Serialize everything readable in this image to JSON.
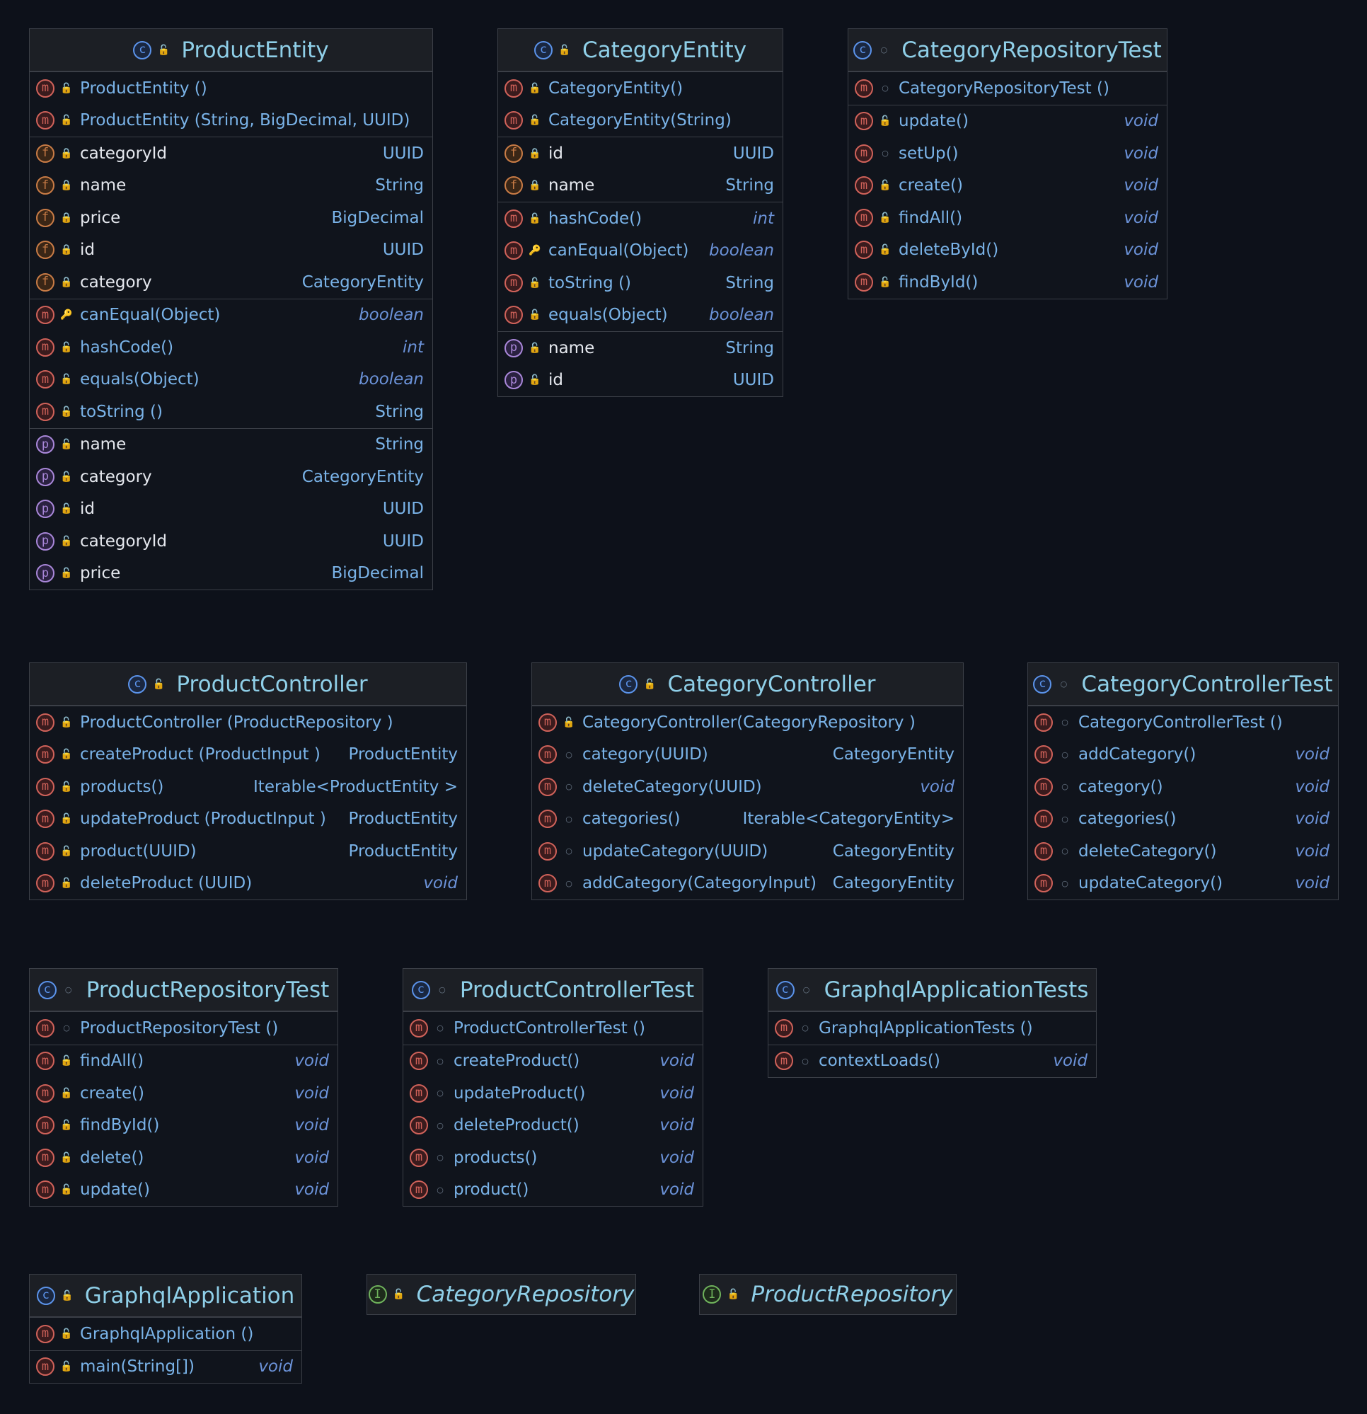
{
  "classes": [
    {
      "id": "product-entity",
      "kind": "c",
      "visibility": "public",
      "title": "ProductEntity",
      "sections": [
        [
          {
            "kind": "m",
            "vis": "public",
            "name": "ProductEntity ()",
            "type": ""
          },
          {
            "kind": "m",
            "vis": "public",
            "name": "ProductEntity (String, BigDecimal, UUID)",
            "type": ""
          }
        ],
        [
          {
            "kind": "f",
            "vis": "private",
            "name": "categoryId",
            "type": "UUID"
          },
          {
            "kind": "f",
            "vis": "private",
            "name": "name",
            "type": "String"
          },
          {
            "kind": "f",
            "vis": "private",
            "name": "price",
            "type": "BigDecimal"
          },
          {
            "kind": "f",
            "vis": "private",
            "name": "id",
            "type": "UUID"
          },
          {
            "kind": "f",
            "vis": "private",
            "name": "category",
            "type": "CategoryEntity"
          }
        ],
        [
          {
            "kind": "m",
            "vis": "protected",
            "name": "canEqual(Object)",
            "type": "boolean",
            "italic": true
          },
          {
            "kind": "m",
            "vis": "public",
            "name": "hashCode()",
            "type": "int",
            "italic": true
          },
          {
            "kind": "m",
            "vis": "public",
            "name": "equals(Object)",
            "type": "boolean",
            "italic": true
          },
          {
            "kind": "m",
            "vis": "public",
            "name": "toString ()",
            "type": "String"
          }
        ],
        [
          {
            "kind": "p",
            "vis": "public",
            "name": "name",
            "type": "String"
          },
          {
            "kind": "p",
            "vis": "public",
            "name": "category",
            "type": "CategoryEntity"
          },
          {
            "kind": "p",
            "vis": "public",
            "name": "id",
            "type": "UUID"
          },
          {
            "kind": "p",
            "vis": "public",
            "name": "categoryId",
            "type": "UUID"
          },
          {
            "kind": "p",
            "vis": "public",
            "name": "price",
            "type": "BigDecimal"
          }
        ]
      ]
    },
    {
      "id": "category-entity",
      "kind": "c",
      "visibility": "public",
      "title": "CategoryEntity",
      "sections": [
        [
          {
            "kind": "m",
            "vis": "public",
            "name": "CategoryEntity()",
            "type": ""
          },
          {
            "kind": "m",
            "vis": "public",
            "name": "CategoryEntity(String)",
            "type": ""
          }
        ],
        [
          {
            "kind": "f",
            "vis": "private",
            "name": "id",
            "type": "UUID"
          },
          {
            "kind": "f",
            "vis": "private",
            "name": "name",
            "type": "String"
          }
        ],
        [
          {
            "kind": "m",
            "vis": "public",
            "name": "hashCode()",
            "type": "int",
            "italic": true
          },
          {
            "kind": "m",
            "vis": "protected",
            "name": "canEqual(Object)",
            "type": "boolean",
            "italic": true
          },
          {
            "kind": "m",
            "vis": "public",
            "name": "toString ()",
            "type": "String"
          },
          {
            "kind": "m",
            "vis": "public",
            "name": "equals(Object)",
            "type": "boolean",
            "italic": true
          }
        ],
        [
          {
            "kind": "p",
            "vis": "public",
            "name": "name",
            "type": "String"
          },
          {
            "kind": "p",
            "vis": "public",
            "name": "id",
            "type": "UUID"
          }
        ]
      ]
    },
    {
      "id": "category-repository-test",
      "kind": "c",
      "visibility": "package",
      "title": "CategoryRepositoryTest",
      "sections": [
        [
          {
            "kind": "m",
            "vis": "package",
            "name": "CategoryRepositoryTest ()",
            "type": ""
          }
        ],
        [
          {
            "kind": "m",
            "vis": "public",
            "name": "update()",
            "type": "void",
            "italic": true
          },
          {
            "kind": "m",
            "vis": "package",
            "name": "setUp()",
            "type": "void",
            "italic": true
          },
          {
            "kind": "m",
            "vis": "public",
            "name": "create()",
            "type": "void",
            "italic": true
          },
          {
            "kind": "m",
            "vis": "public",
            "name": "findAll()",
            "type": "void",
            "italic": true
          },
          {
            "kind": "m",
            "vis": "public",
            "name": "deleteById()",
            "type": "void",
            "italic": true
          },
          {
            "kind": "m",
            "vis": "public",
            "name": "findById()",
            "type": "void",
            "italic": true
          }
        ]
      ]
    },
    {
      "id": "product-controller",
      "kind": "c",
      "visibility": "public",
      "title": "ProductController",
      "sections": [
        [
          {
            "kind": "m",
            "vis": "public",
            "name": "ProductController (ProductRepository )",
            "type": ""
          },
          {
            "kind": "m",
            "vis": "public",
            "name": "createProduct (ProductInput )",
            "type": "ProductEntity"
          },
          {
            "kind": "m",
            "vis": "public",
            "name": "products()",
            "type": "Iterable<ProductEntity >"
          },
          {
            "kind": "m",
            "vis": "public",
            "name": "updateProduct (ProductInput )",
            "type": "ProductEntity"
          },
          {
            "kind": "m",
            "vis": "public",
            "name": "product(UUID)",
            "type": "ProductEntity"
          },
          {
            "kind": "m",
            "vis": "public",
            "name": "deleteProduct (UUID)",
            "type": "void",
            "italic": true
          }
        ]
      ]
    },
    {
      "id": "category-controller",
      "kind": "c",
      "visibility": "public",
      "title": "CategoryController",
      "sections": [
        [
          {
            "kind": "m",
            "vis": "public",
            "name": "CategoryController(CategoryRepository )",
            "type": ""
          },
          {
            "kind": "m",
            "vis": "package",
            "name": "category(UUID)",
            "type": "CategoryEntity"
          },
          {
            "kind": "m",
            "vis": "package",
            "name": "deleteCategory(UUID)",
            "type": "void",
            "italic": true
          },
          {
            "kind": "m",
            "vis": "package",
            "name": "categories()",
            "type": "Iterable<CategoryEntity>"
          },
          {
            "kind": "m",
            "vis": "package",
            "name": "updateCategory(UUID)",
            "type": "CategoryEntity"
          },
          {
            "kind": "m",
            "vis": "package",
            "name": "addCategory(CategoryInput)",
            "type": "CategoryEntity"
          }
        ]
      ]
    },
    {
      "id": "category-controller-test",
      "kind": "c",
      "visibility": "package",
      "title": "CategoryControllerTest",
      "sections": [
        [
          {
            "kind": "m",
            "vis": "package",
            "name": "CategoryControllerTest ()",
            "type": ""
          },
          {
            "kind": "m",
            "vis": "package",
            "name": "addCategory()",
            "type": "void",
            "italic": true
          },
          {
            "kind": "m",
            "vis": "package",
            "name": "category()",
            "type": "void",
            "italic": true
          },
          {
            "kind": "m",
            "vis": "package",
            "name": "categories()",
            "type": "void",
            "italic": true
          },
          {
            "kind": "m",
            "vis": "package",
            "name": "deleteCategory()",
            "type": "void",
            "italic": true
          },
          {
            "kind": "m",
            "vis": "package",
            "name": "updateCategory()",
            "type": "void",
            "italic": true
          }
        ]
      ]
    },
    {
      "id": "product-repository-test",
      "kind": "c",
      "visibility": "package",
      "title": "ProductRepositoryTest",
      "sections": [
        [
          {
            "kind": "m",
            "vis": "package",
            "name": "ProductRepositoryTest ()",
            "type": ""
          }
        ],
        [
          {
            "kind": "m",
            "vis": "public",
            "name": "findAll()",
            "type": "void",
            "italic": true
          },
          {
            "kind": "m",
            "vis": "public",
            "name": "create()",
            "type": "void",
            "italic": true
          },
          {
            "kind": "m",
            "vis": "public",
            "name": "findById()",
            "type": "void",
            "italic": true
          },
          {
            "kind": "m",
            "vis": "public",
            "name": "delete()",
            "type": "void",
            "italic": true
          },
          {
            "kind": "m",
            "vis": "public",
            "name": "update()",
            "type": "void",
            "italic": true
          }
        ]
      ]
    },
    {
      "id": "product-controller-test",
      "kind": "c",
      "visibility": "package",
      "title": "ProductControllerTest",
      "sections": [
        [
          {
            "kind": "m",
            "vis": "package",
            "name": "ProductControllerTest ()",
            "type": ""
          }
        ],
        [
          {
            "kind": "m",
            "vis": "package",
            "name": "createProduct()",
            "type": "void",
            "italic": true
          },
          {
            "kind": "m",
            "vis": "package",
            "name": "updateProduct()",
            "type": "void",
            "italic": true
          },
          {
            "kind": "m",
            "vis": "package",
            "name": "deleteProduct()",
            "type": "void",
            "italic": true
          },
          {
            "kind": "m",
            "vis": "package",
            "name": "products()",
            "type": "void",
            "italic": true
          },
          {
            "kind": "m",
            "vis": "package",
            "name": "product()",
            "type": "void",
            "italic": true
          }
        ]
      ]
    },
    {
      "id": "graphql-application-tests",
      "kind": "c",
      "visibility": "package",
      "title": "GraphqlApplicationTests",
      "sections": [
        [
          {
            "kind": "m",
            "vis": "package",
            "name": "GraphqlApplicationTests ()",
            "type": ""
          }
        ],
        [
          {
            "kind": "m",
            "vis": "package",
            "name": "contextLoads()",
            "type": "void",
            "italic": true
          }
        ]
      ]
    },
    {
      "id": "graphql-application",
      "kind": "c",
      "visibility": "public",
      "title": "GraphqlApplication",
      "sections": [
        [
          {
            "kind": "m",
            "vis": "public",
            "name": "GraphqlApplication ()",
            "type": ""
          }
        ],
        [
          {
            "kind": "m",
            "vis": "public",
            "name": "main(String[])",
            "type": "void",
            "italic": true
          }
        ]
      ]
    },
    {
      "id": "category-repository",
      "kind": "i",
      "visibility": "public",
      "title": "CategoryRepository",
      "sections": []
    },
    {
      "id": "product-repository",
      "kind": "i",
      "visibility": "public",
      "title": "ProductRepository",
      "sections": []
    }
  ],
  "icons": {
    "kind_letters": {
      "c": "c",
      "m": "m",
      "f": "f",
      "p": "p",
      "i": "I"
    },
    "visibility_glyphs": {
      "public": "🔓",
      "private": "🔒",
      "package": "○",
      "protected": "🔑"
    },
    "colors": {
      "background": "#0d111a",
      "method": "#d0625a",
      "field": "#c97c46",
      "property": "#a987d9",
      "class": "#5b93ea",
      "interface": "#6fb25c",
      "name": "#7ab3e8",
      "title": "#8fcfe8"
    }
  }
}
